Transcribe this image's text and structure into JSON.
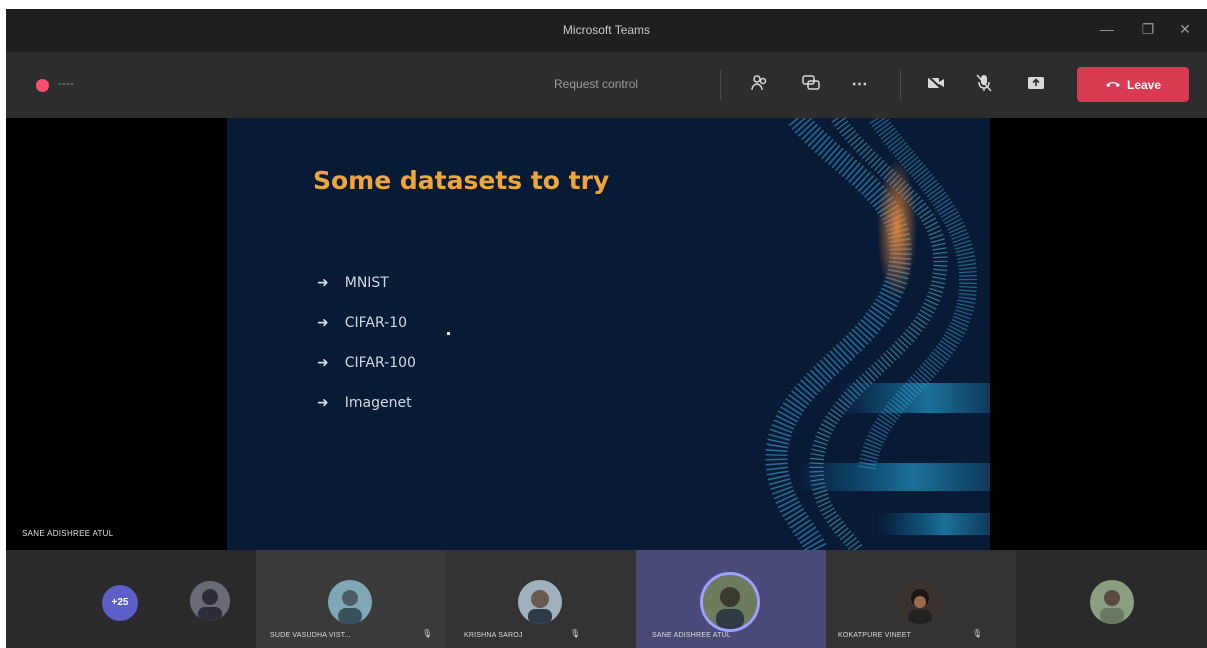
{
  "window": {
    "title": "Microsoft Teams",
    "minimize_icon": "minimize-icon",
    "restore_icon": "restore-icon",
    "close_icon": "close-icon"
  },
  "toolbar": {
    "timer": "----",
    "request_control": "Request control",
    "leave_label": "Leave",
    "icons": [
      "people-icon",
      "chat-icon",
      "more-icon",
      "camera-off-icon",
      "mic-off-icon",
      "share-screen-icon",
      "hangup-icon"
    ]
  },
  "slide": {
    "title": "Some datasets to try",
    "bullets": [
      "MNIST",
      "CIFAR-10",
      "CIFAR-100",
      "Imagenet"
    ]
  },
  "presenter_name": "SANE ADISHREE ATUL",
  "participants": {
    "overflow_count": "+25",
    "tiles": [
      {
        "name": "SUDE VASUDHA VIST...",
        "muted": true
      },
      {
        "name": "KRISHNA SAROJ",
        "muted": true
      },
      {
        "name": "SANE ADISHREE ATUL",
        "muted": false
      },
      {
        "name": "KOKATPURE VINEET",
        "muted": true
      }
    ]
  },
  "colors": {
    "leave_button": "#d83a52",
    "slide_title": "#f0a53a",
    "overflow_avatar": "#5b5fc7",
    "active_tile": "#4a4a78"
  }
}
